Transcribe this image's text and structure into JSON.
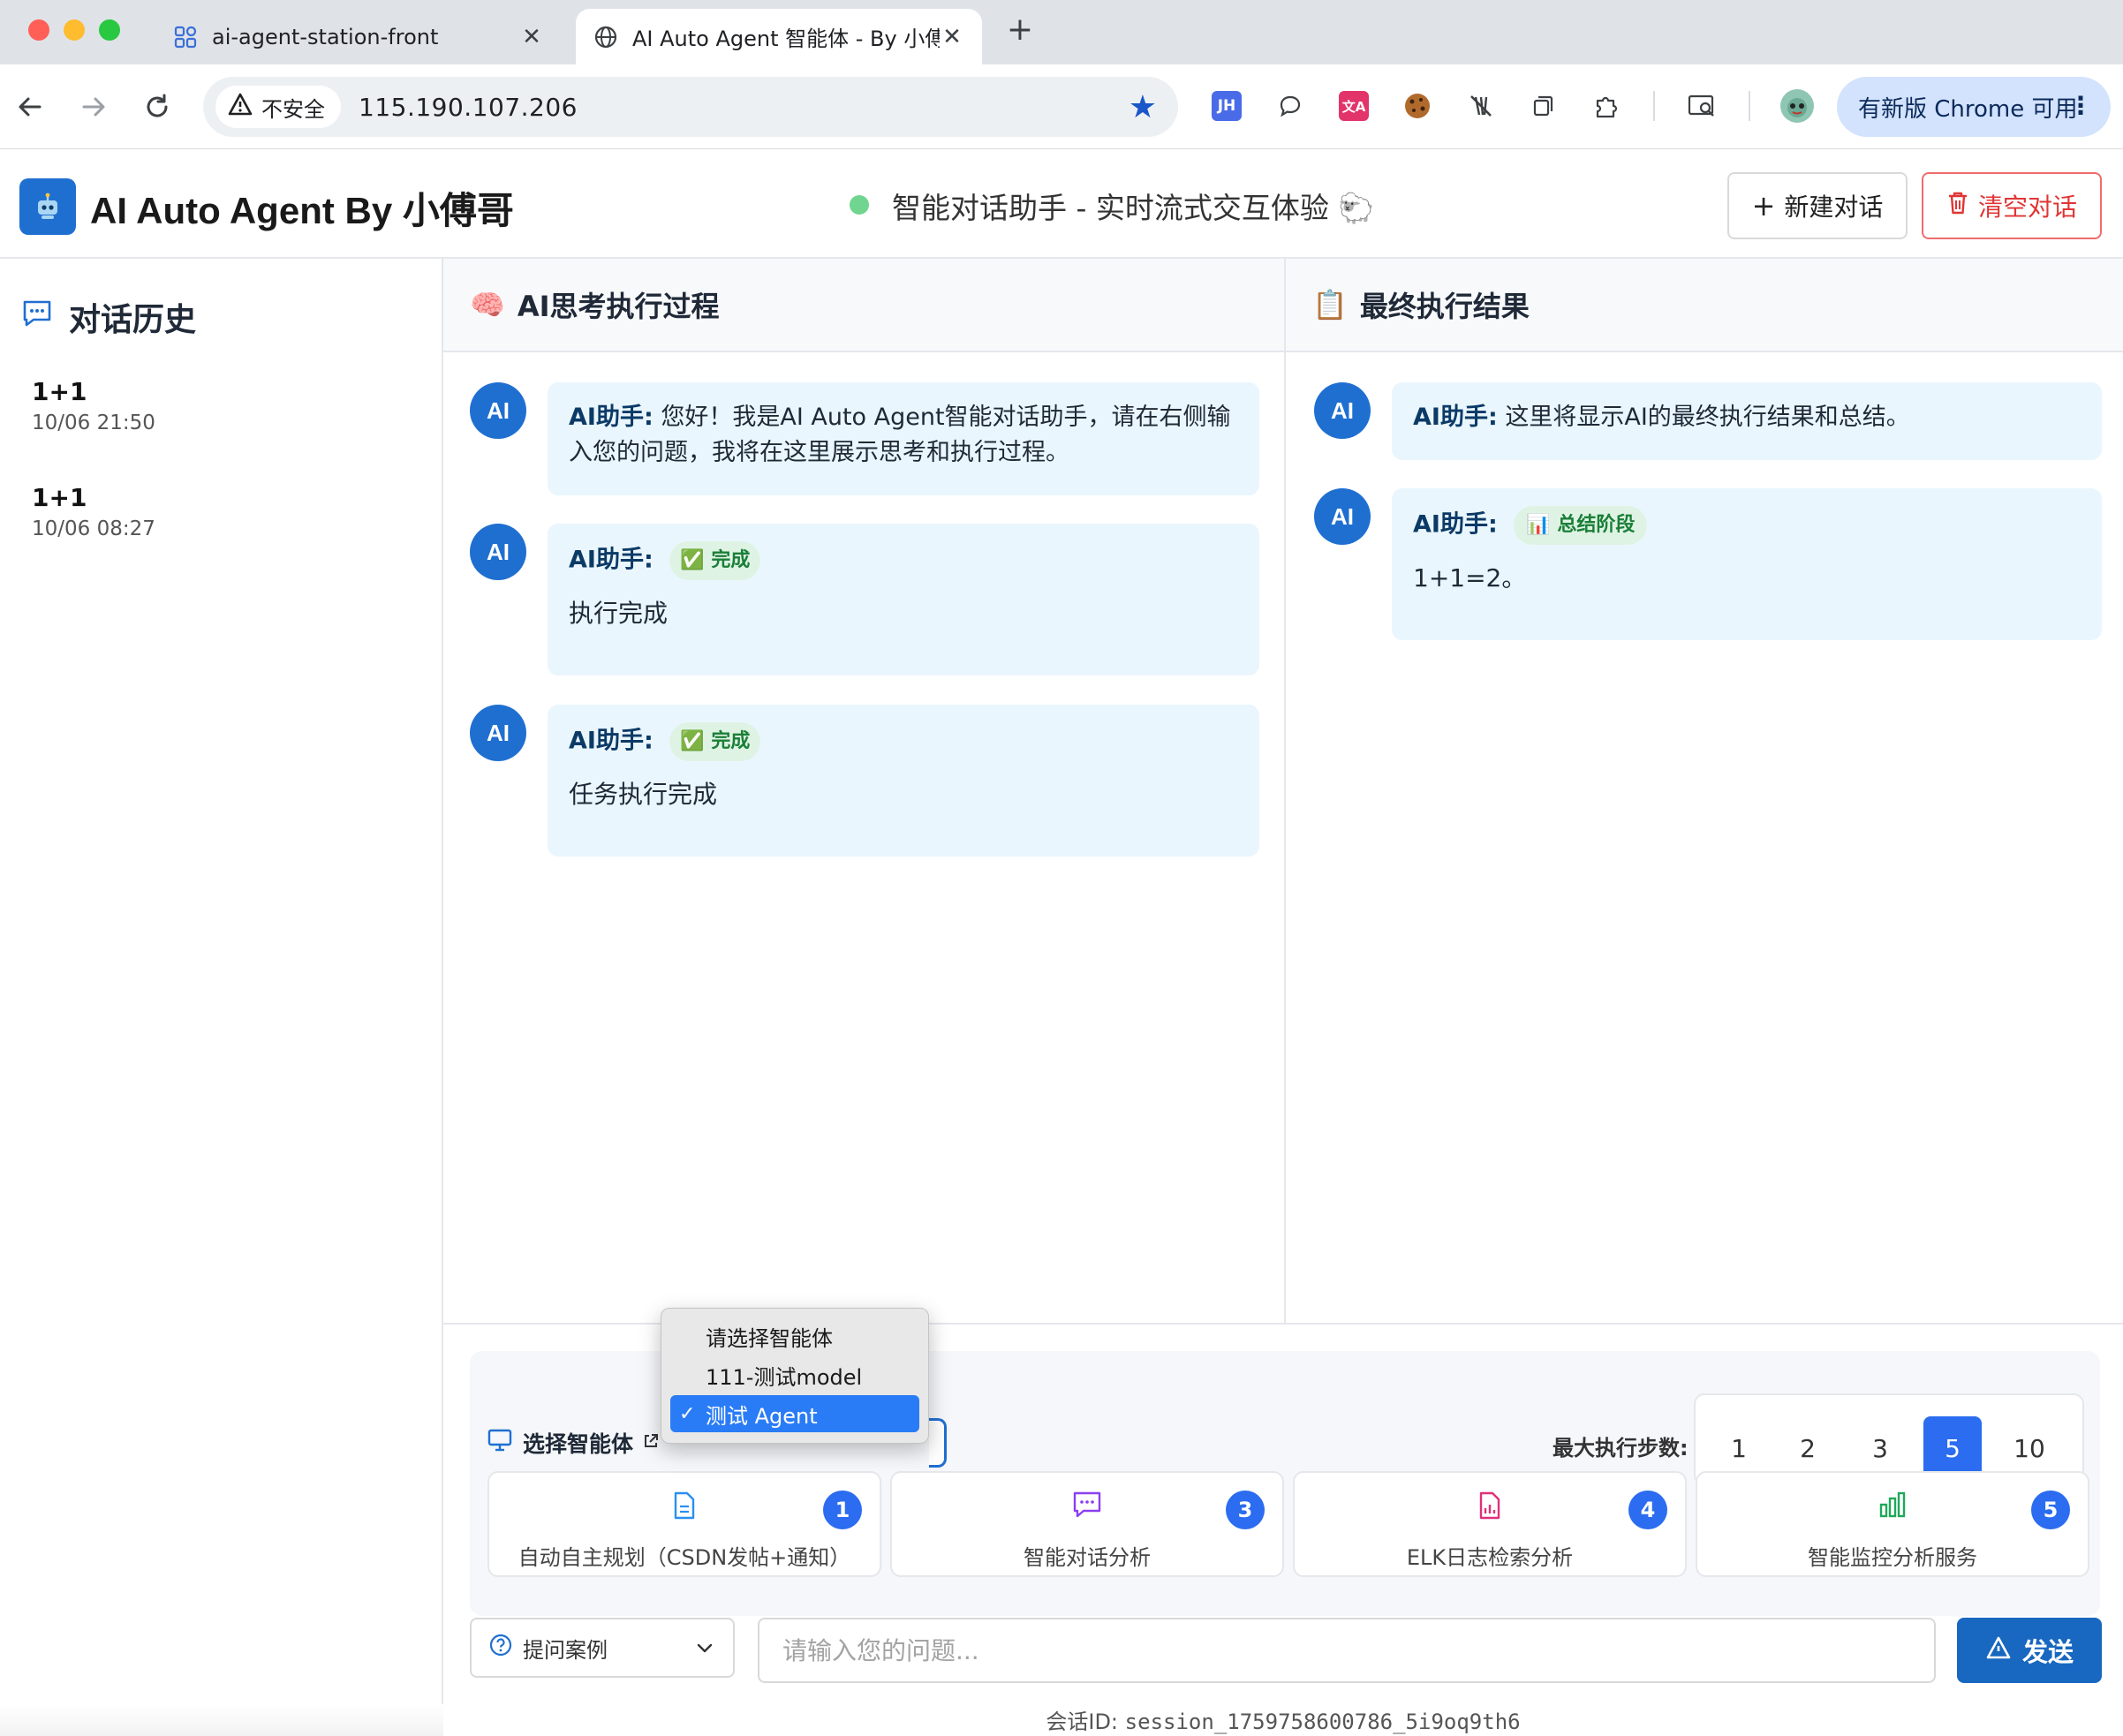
{
  "browser": {
    "tabs": [
      {
        "title": "ai-agent-station-front",
        "icon": "app-grid-icon",
        "active": false
      },
      {
        "title": "AI Auto Agent 智能体 - By 小傅",
        "icon": "globe-icon",
        "active": true
      }
    ],
    "security_label": "不安全",
    "url": "115.190.107.206",
    "update_label": "有新版 Chrome 可用",
    "extensions": [
      "jh-extension-icon",
      "chat-bubble-icon",
      "translate-icon",
      "cookie-icon",
      "blocker-icon",
      "tab-copy-icon",
      "puzzle-icon",
      "tab-search-icon",
      "profile-avatar-icon"
    ]
  },
  "header": {
    "title": "AI Auto Agent By 小傅哥",
    "subtitle": "智能对话助手 - 实时流式交互体验 🐑",
    "status_color": "#6fd58f",
    "new_chat": "新建对话",
    "clear_chat": "清空对话"
  },
  "sidebar": {
    "title": "对话历史",
    "items": [
      {
        "title": "1+1",
        "time": "10/06 21:50"
      },
      {
        "title": "1+1",
        "time": "10/06 08:27"
      }
    ]
  },
  "thinking_panel": {
    "title": "AI思考执行过程",
    "icon": "🧠",
    "messages": [
      {
        "avatar": "AI",
        "speaker": "AI助手:",
        "text": "您好！我是AI Auto Agent智能对话助手，请在右侧输入您的问题，我将在这里展示思考和执行过程。"
      },
      {
        "avatar": "AI",
        "speaker": "AI助手:",
        "badge": "✅ 完成",
        "body": "执行完成"
      },
      {
        "avatar": "AI",
        "speaker": "AI助手:",
        "badge": "✅ 完成",
        "body": "任务执行完成"
      }
    ]
  },
  "result_panel": {
    "title": "最终执行结果",
    "icon": "📋",
    "messages": [
      {
        "avatar": "AI",
        "speaker": "AI助手:",
        "text": "这里将显示AI的最终执行结果和总结。"
      },
      {
        "avatar": "AI",
        "speaker": "AI助手:",
        "badge": "📊 总结阶段",
        "body": "1+1=2。"
      }
    ]
  },
  "config": {
    "agent_label": "选择智能体",
    "agent_options": [
      "请选择智能体",
      "111-测试model",
      "测试 Agent"
    ],
    "agent_selected": "测试 Agent",
    "steps_label": "最大执行步数:",
    "steps": [
      "1",
      "2",
      "3",
      "5",
      "10"
    ],
    "steps_selected": "5",
    "cards": [
      {
        "label": "自动自主规划（CSDN发帖+通知）",
        "num": "1",
        "icon": "document-icon",
        "color": "#2b8ff0"
      },
      {
        "label": "智能对话分析",
        "num": "3",
        "icon": "chat-icon",
        "color": "#8b3ff0"
      },
      {
        "label": "ELK日志检索分析",
        "num": "4",
        "icon": "report-icon",
        "color": "#e0307a"
      },
      {
        "label": "智能监控分析服务",
        "num": "5",
        "icon": "bar-chart-icon",
        "color": "#1fa85b"
      }
    ]
  },
  "input": {
    "examples_label": "提问案例",
    "placeholder": "请输入您的问题...",
    "send_label": "发送"
  },
  "session": {
    "label": "会话ID:",
    "id": "session_1759758600786_5i9oq9th6"
  }
}
